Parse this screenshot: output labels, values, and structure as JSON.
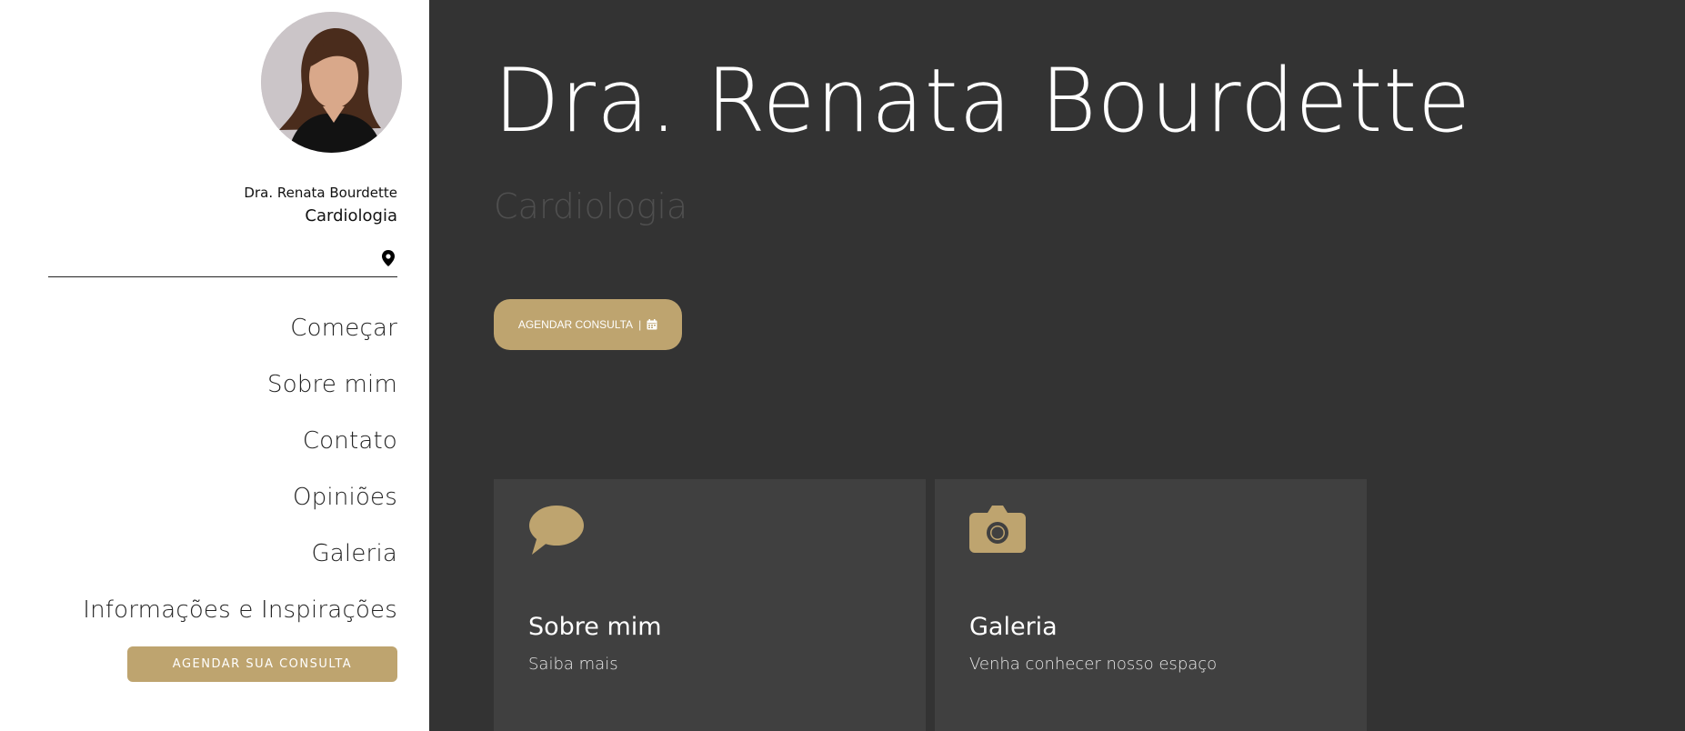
{
  "sidebar": {
    "doctor_name": "Dra. Renata Bourdette",
    "specialty": "Cardiologia",
    "nav": [
      {
        "label": "Começar"
      },
      {
        "label": "Sobre mim"
      },
      {
        "label": "Contato"
      },
      {
        "label": "Opiniões"
      },
      {
        "label": "Galeria"
      },
      {
        "label": "Informações e Inspirações"
      }
    ],
    "book_button": "AGENDAR SUA CONSULTA",
    "location_icon": "map-pin-icon"
  },
  "hero": {
    "title": "Dra. Renata Bourdette",
    "subtitle": "Cardiologia",
    "cta_label": "AGENDAR CONSULTA",
    "cta_separator": "|",
    "cta_icon": "calendar-icon"
  },
  "cards": [
    {
      "icon": "speech-bubble-icon",
      "title": "Sobre mim",
      "subtitle": "Saiba mais"
    },
    {
      "icon": "camera-icon",
      "title": "Galeria",
      "subtitle": "Venha conhecer nosso espaço"
    }
  ],
  "colors": {
    "accent": "#bea46f",
    "main_background": "#333333",
    "card_background": "#404040",
    "sidebar_background": "#ffffff"
  }
}
